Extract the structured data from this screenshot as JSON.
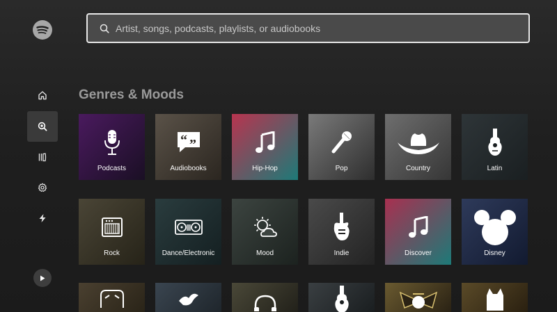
{
  "app": {
    "logo_icon": "spotify-logo-icon"
  },
  "sidebar": {
    "items": [
      {
        "name": "home",
        "icon": "home-icon",
        "active": false
      },
      {
        "name": "search",
        "icon": "search-icon",
        "active": true
      },
      {
        "name": "library",
        "icon": "library-icon",
        "active": false
      },
      {
        "name": "settings",
        "icon": "gear-icon",
        "active": false
      },
      {
        "name": "lightning",
        "icon": "lightning-icon",
        "active": false
      }
    ],
    "play_icon": "play-icon"
  },
  "search": {
    "placeholder": "Artist, songs, podcasts, playlists, or audiobooks",
    "value": ""
  },
  "section": {
    "title": "Genres & Moods"
  },
  "tiles": [
    {
      "label": "Podcasts",
      "icon": "microphone-icon",
      "colors": [
        "#4a1a5e",
        "#1a0f24"
      ]
    },
    {
      "label": "Audiobooks",
      "icon": "quote-bubble-icon",
      "colors": [
        "#5a5248",
        "#2b2620"
      ]
    },
    {
      "label": "Hip-Hop",
      "icon": "music-note-icon",
      "colors": [
        "#b8344f",
        "#1d7a78"
      ]
    },
    {
      "label": "Pop",
      "icon": "microphone-handheld-icon",
      "colors": [
        "#7a7a7a",
        "#2e2e2e"
      ]
    },
    {
      "label": "Country",
      "icon": "cowboy-hat-icon",
      "colors": [
        "#6e6e6e",
        "#363636"
      ]
    },
    {
      "label": "Latin",
      "icon": "guitar-icon",
      "colors": [
        "#2e3538",
        "#1a1f21"
      ]
    },
    {
      "label": "Rock",
      "icon": "amplifier-icon",
      "colors": [
        "#4a4536",
        "#262318"
      ]
    },
    {
      "label": "Dance/Electronic",
      "icon": "turntables-icon",
      "colors": [
        "#2a3c3e",
        "#141f21"
      ]
    },
    {
      "label": "Mood",
      "icon": "sun-cloud-icon",
      "colors": [
        "#3c4440",
        "#1c221f"
      ]
    },
    {
      "label": "Indie",
      "icon": "electric-guitar-icon",
      "colors": [
        "#4a4a4a",
        "#232323"
      ]
    },
    {
      "label": "Discover",
      "icon": "music-note-icon",
      "colors": [
        "#a83050",
        "#1d7a78"
      ]
    },
    {
      "label": "Disney",
      "icon": "mickey-icon",
      "colors": [
        "#2e3a5a",
        "#121a30"
      ]
    },
    {
      "label": "",
      "icon": "robot-icon",
      "colors": [
        "#4a4030",
        "#2a2418"
      ]
    },
    {
      "label": "",
      "icon": "dove-icon",
      "colors": [
        "#3a4550",
        "#1f262c"
      ]
    },
    {
      "label": "",
      "icon": "headphones-icon",
      "colors": [
        "#4a4838",
        "#22211a"
      ]
    },
    {
      "label": "",
      "icon": "guitar-icon",
      "colors": [
        "#3a3f42",
        "#1a1e20"
      ]
    },
    {
      "label": "",
      "icon": "emblem-icon",
      "colors": [
        "#6a5a30",
        "#2a2214"
      ]
    },
    {
      "label": "",
      "icon": "cat-icon",
      "colors": [
        "#5a4a28",
        "#2a2010"
      ]
    }
  ]
}
